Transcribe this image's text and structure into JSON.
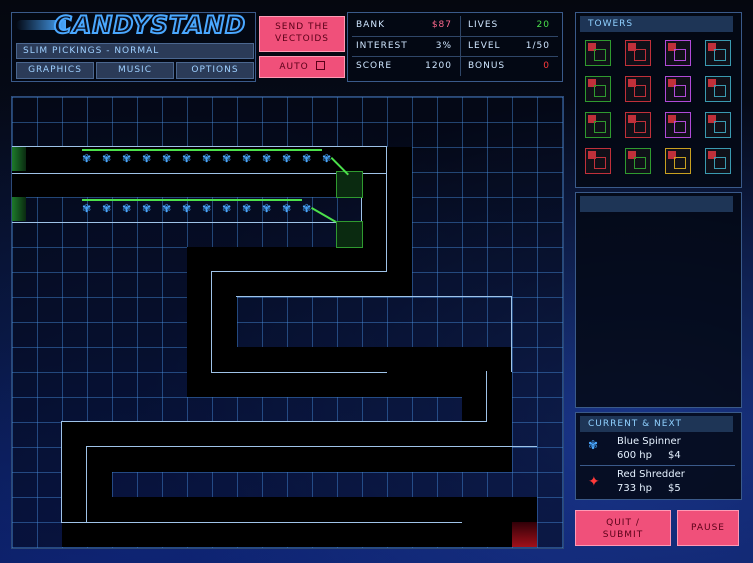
{
  "logo": {
    "text": "CANDYSTAND"
  },
  "level_info": {
    "label": "SLIM PICKINGS - NORMAL"
  },
  "menu": {
    "graphics": "GRAPHICS",
    "music": "MUSIC",
    "options": "OPTIONS"
  },
  "send_button": {
    "line1": "SEND THE",
    "line2": "VECTOIDS"
  },
  "auto_button": {
    "label": "AUTO",
    "checked": false
  },
  "stats": {
    "bank_label": "BANK",
    "bank_value": "$87",
    "lives_label": "LIVES",
    "lives_value": "20",
    "interest_label": "INTEREST",
    "interest_value": "3%",
    "level_label": "LEVEL",
    "level_value": "1/50",
    "score_label": "SCORE",
    "score_value": "1200",
    "bonus_label": "BONUS",
    "bonus_value": "0"
  },
  "colors": {
    "bank": "#ff6a8e",
    "lives": "#4be04b",
    "bonus": "#ff3a3a",
    "accent": "#f0507a"
  },
  "towers_panel": {
    "title": "TOWERS",
    "towers": [
      {
        "name": "green-tower-1",
        "color": "#2f9a2f"
      },
      {
        "name": "red-tower-1",
        "color": "#c0303a"
      },
      {
        "name": "purple-tower-1",
        "color": "#b04ad8"
      },
      {
        "name": "teal-tower-1",
        "color": "#3a9ab0"
      },
      {
        "name": "green-tower-2",
        "color": "#2f9a2f"
      },
      {
        "name": "red-tower-2",
        "color": "#c0303a"
      },
      {
        "name": "purple-tower-2",
        "color": "#b04ad8"
      },
      {
        "name": "teal-tower-2",
        "color": "#3a9ab0"
      },
      {
        "name": "green-tower-3",
        "color": "#2f9a2f"
      },
      {
        "name": "red-tower-3",
        "color": "#c0303a"
      },
      {
        "name": "purple-tower-3",
        "color": "#b04ad8"
      },
      {
        "name": "teal-tower-3",
        "color": "#3a9ab0"
      },
      {
        "name": "red-special-tower",
        "color": "#c0303a"
      },
      {
        "name": "green-special-tower",
        "color": "#2f9a2f"
      },
      {
        "name": "yellow-special-tower",
        "color": "#c8a020"
      },
      {
        "name": "teal-special-tower",
        "color": "#3a9ab0"
      }
    ]
  },
  "current_next": {
    "title": "CURRENT & NEXT",
    "current": {
      "name": "Blue Spinner",
      "hp": "600 hp",
      "reward": "$4",
      "icon": "blue-spinner-icon"
    },
    "next": {
      "name": "Red Shredder",
      "hp": "733 hp",
      "reward": "$5",
      "icon": "red-shredder-icon"
    }
  },
  "buttons": {
    "quit_line1": "QUIT /",
    "quit_line2": "SUBMIT",
    "pause": "PAUSE"
  },
  "glyphs": {
    "spinner": "✾",
    "shredder": "✦"
  }
}
